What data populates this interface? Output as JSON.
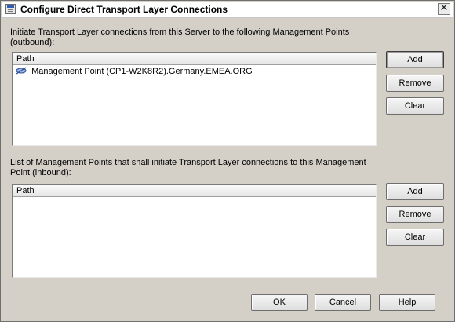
{
  "window": {
    "title": "Configure Direct Transport Layer Connections",
    "close_glyph": "✕"
  },
  "outbound": {
    "label_line1": "Initiate Transport Layer connections from this Server to the following Management Points",
    "label_line2": "(outbound):",
    "column_header": "Path",
    "items": [
      {
        "icon": "management-point-icon",
        "text": "Management Point (CP1-W2K8R2).Germany.EMEA.ORG"
      }
    ],
    "buttons": {
      "add": "Add",
      "remove": "Remove",
      "clear": "Clear"
    }
  },
  "inbound": {
    "label_line1": "List of Management Points that shall initiate Transport Layer connections to this Management",
    "label_line2": "Point (inbound):",
    "column_header": "Path",
    "items": [],
    "buttons": {
      "add": "Add",
      "remove": "Remove",
      "clear": "Clear"
    }
  },
  "footer": {
    "ok": "OK",
    "cancel": "Cancel",
    "help": "Help"
  }
}
